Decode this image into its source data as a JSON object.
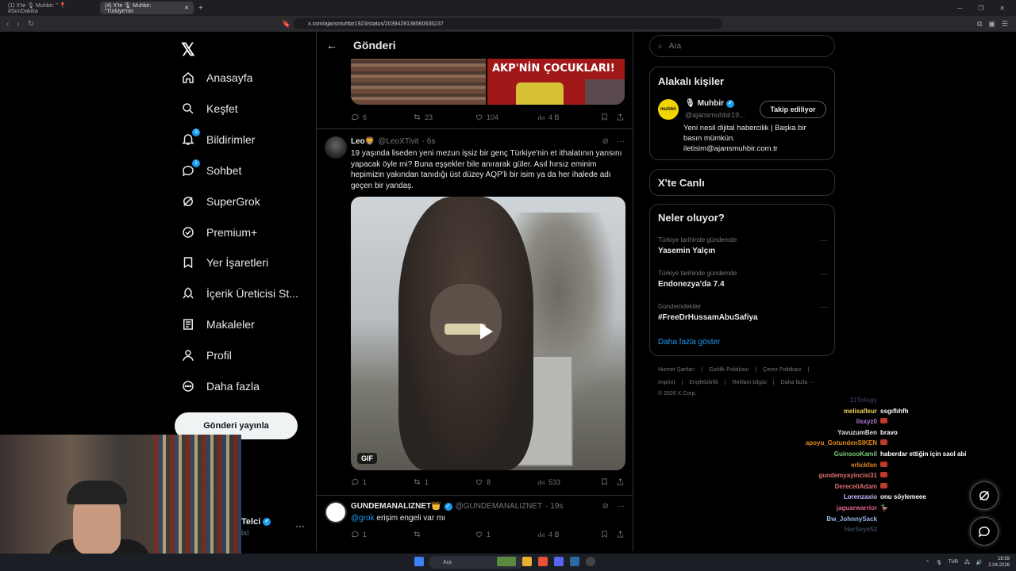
{
  "browser": {
    "tabs": [
      {
        "label": "(1) X'te 🎙 Muhbir: \" 📍 #SonDakika"
      },
      {
        "label": "(4) X'te 🎙 Muhbir: \"Türkiye'nin"
      }
    ],
    "url": "x.com/ajansmuhbir1923/status/2039428138560635237"
  },
  "nav": {
    "items": [
      {
        "label": "Anasayfa",
        "icon": "home-icon"
      },
      {
        "label": "Keşfet",
        "icon": "search-icon"
      },
      {
        "label": "Bildirimler",
        "icon": "bell-icon",
        "badge": "3"
      },
      {
        "label": "Sohbet",
        "icon": "chat-icon",
        "badge": "1"
      },
      {
        "label": "SuperGrok",
        "icon": "grok-icon"
      },
      {
        "label": "Premium+",
        "icon": "premium-icon"
      },
      {
        "label": "Yer İşaretleri",
        "icon": "bookmark-icon"
      },
      {
        "label": "İçerik Üreticisi St...",
        "icon": "rocket-icon"
      },
      {
        "label": "Makaleler",
        "icon": "article-icon"
      },
      {
        "label": "Profil",
        "icon": "person-icon"
      },
      {
        "label": "Daha fazla",
        "icon": "more-circle-icon"
      }
    ],
    "post_button": "Gönderi yayınla",
    "account_name": "Telci",
    "account_handle": "ixi"
  },
  "header": {
    "title": "Gönderi"
  },
  "quoted_image_label": "AKP'NİN ÇOCUKLARI!",
  "post1_actions": {
    "replies": "6",
    "reposts": "23",
    "likes": "104",
    "views": "4 B"
  },
  "post2": {
    "name": "Leo🦁",
    "handle": "@LeoXTivit",
    "time": "· 6s",
    "text": "19 yaşında liseden yeni mezun işsiz  bir genç Türkiye'nin et ithalatının yarısını yapacak öyle mi? Buna eşşekler bile anırarak güler. Asıl hırsız eminim hepimizin yakından tanıdığı üst düzey AQP'li bir isim ya da her ihalede adı geçen bir yandaş.",
    "media_badge": "GIF",
    "actions": {
      "replies": "1",
      "reposts": "1",
      "likes": "8",
      "views": "533"
    }
  },
  "post3": {
    "name": "GUNDEMANALIZNET👑",
    "handle": "@GUNDEMANALIZNET",
    "time": "· 19s",
    "mention": "@grok",
    "text": " erişim engeli var mı",
    "actions": {
      "replies": "1",
      "reposts": "",
      "likes": "1",
      "views": "4 B"
    }
  },
  "right": {
    "search_placeholder": "Ara",
    "related_title": "Alakalı kişiler",
    "related": {
      "name": "Muhbir",
      "handle": "@ajansmuhbir19...",
      "logo": "muhbir",
      "follow_label": "Takip ediliyor",
      "bio": "Yeni nesil dijital habercilik | Başka bir basın mümkün. iletisim@ajansmuhbir.com.tr"
    },
    "live_title": "X'te Canlı",
    "trending_title": "Neler oluyor?",
    "trends": [
      {
        "category": "Türkiye tarihinde gündemde",
        "title": "Yasemin Yalçın"
      },
      {
        "category": "Türkiye tarihinde gündemde",
        "title": "Endonezya'da 7.4"
      },
      {
        "category": "Gündemdekiler",
        "title": "#FreeDrHussamAbuSafiya"
      }
    ],
    "show_more": "Daha fazla göster",
    "footer_row1": [
      "Hizmet Şartları",
      "|",
      "Gizlilik Politikası",
      "|",
      "Çerez Politikası",
      "|"
    ],
    "footer_row2": [
      "Imprint",
      "|",
      "Erişilebilirlik",
      "|",
      "Reklam bilgisi",
      "|",
      "Daha fazla ···"
    ],
    "copyright": "© 2026 X Corp."
  },
  "chat": [
    {
      "user": "11Tology",
      "msg": "",
      "color": "#b57edc"
    },
    {
      "user": "melisafleur",
      "msg": "ssgıflıhfh",
      "color": "#f0d060"
    },
    {
      "user": "lisxyz0",
      "msg": "",
      "color": "#b57edc",
      "emote": true
    },
    {
      "user": "YavuzumBen",
      "msg": "bravo",
      "color": "#e0e0e0"
    },
    {
      "user": "apoyu_GotundenSIKEN",
      "msg": "",
      "color": "#e08a20",
      "emote": true
    },
    {
      "user": "GuinsooKamil",
      "msg": "haberdar ettiğin için saol abi",
      "color": "#7ad07a"
    },
    {
      "user": "erlickfan",
      "msg": "",
      "color": "#e08a20",
      "emote": true
    },
    {
      "user": "gundemyayincisi31",
      "msg": "",
      "color": "#e07070",
      "emote": true
    },
    {
      "user": "DereceliAdam",
      "msg": "",
      "color": "#e07070",
      "emote": true
    },
    {
      "user": "Lorenzaxio",
      "msg": "onu söylemeee",
      "color": "#c0c0ff"
    },
    {
      "user": "jaguarwarrior",
      "msg": "🦆",
      "color": "#e0608a"
    },
    {
      "user": "Bw_JohnnySack",
      "msg": "",
      "color": "#9ab8e8"
    },
    {
      "user": "HerSeye53",
      "msg": "",
      "color": "#9ab8e8"
    }
  ],
  "taskbar": {
    "search": "Ara",
    "lang": "TUR",
    "time": "18:59",
    "date": "2.04.2026"
  },
  "colors": {
    "accent": "#1d9bf0",
    "background": "#000000",
    "border": "#2f3336",
    "muted": "#71767b"
  }
}
